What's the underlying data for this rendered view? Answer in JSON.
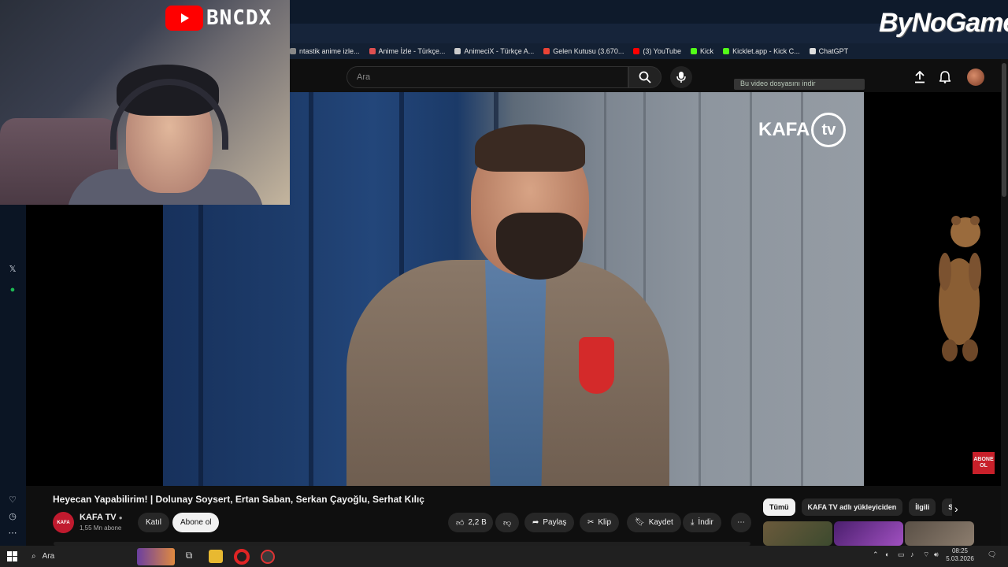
{
  "overlays": {
    "streamer_logo_text": "BNCDX",
    "sponsor_text": "ByNoGame",
    "download_hint": "Bu video dosyasını indir",
    "abone_ol_badge": "ABONE OL",
    "channel_watermark": "KAFA",
    "channel_watermark_tv": "tv"
  },
  "bookmarks": [
    {
      "label": "ntastik anime izle...",
      "color": "#888888"
    },
    {
      "label": "Anime İzle - Türkçe...",
      "color": "#e05050"
    },
    {
      "label": "AnimeciX - Türkçe A...",
      "color": "#cccccc"
    },
    {
      "label": "Gelen Kutusu (3.670...",
      "color": "#ea4335"
    },
    {
      "label": "(3) YouTube",
      "color": "#ff0000"
    },
    {
      "label": "Kick",
      "color": "#53fc18"
    },
    {
      "label": "Kicklet.app - Kick C...",
      "color": "#53fc18"
    },
    {
      "label": "ChatGPT",
      "color": "#dddddd"
    }
  ],
  "header": {
    "search_placeholder": "Ara",
    "search_icon": "search-icon",
    "mic_icon": "mic-icon",
    "upload_icon": "upload-icon",
    "bell_icon": "bell-icon"
  },
  "video": {
    "title": "Heyecan Yapabilirim! | Dolunay Soysert, Ertan Saban, Serkan Çayoğlu, Serhat Kılıç",
    "channel_name": "KAFA TV",
    "channel_verified_icon": "verified-icon",
    "subscribers": "1,55 Mn abone",
    "join_label": "Katıl",
    "subscribe_label": "Abone ol",
    "like_count": "2,2 B",
    "share_label": "Paylaş",
    "clip_label": "Klip",
    "save_label": "Kaydet",
    "download_label": "İndir"
  },
  "chips": [
    {
      "label": "Tümü",
      "active": true
    },
    {
      "label": "KAFA TV adlı yükleyiciden",
      "active": false
    },
    {
      "label": "İlgili",
      "active": false
    },
    {
      "label": "Si...",
      "active": false
    }
  ],
  "taskbar": {
    "search_label": "Ara",
    "time": "08:25",
    "date": "5.03.2026"
  },
  "colors": {
    "youtube_red": "#ff0000",
    "kafa_red": "#c01a2e",
    "background": "#0f0f0f"
  }
}
